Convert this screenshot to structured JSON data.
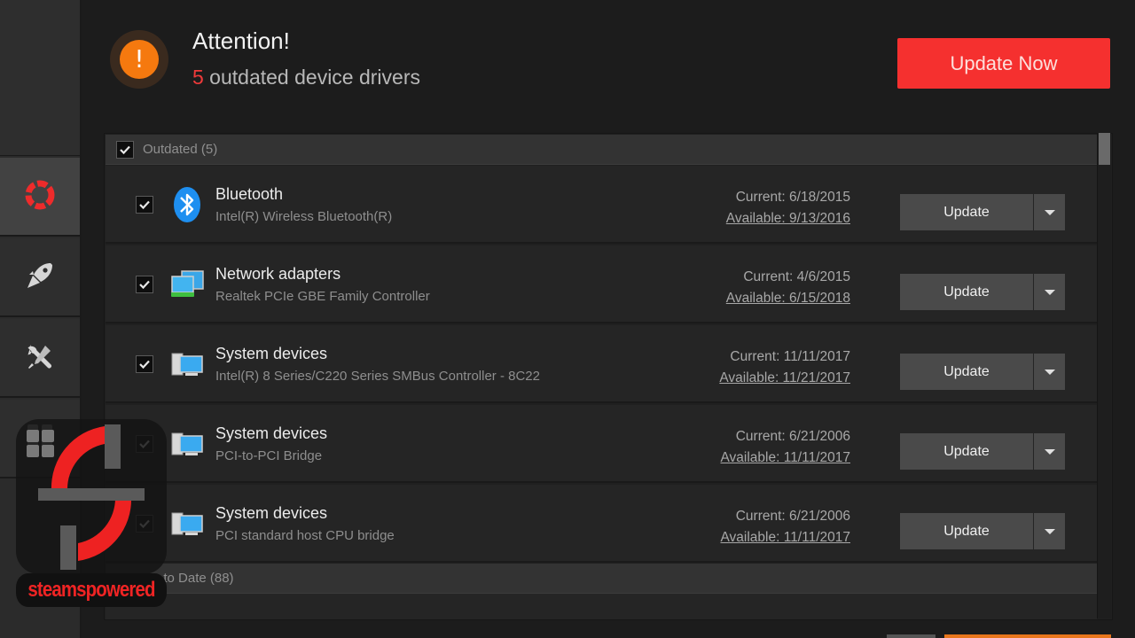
{
  "header": {
    "title": "Attention!",
    "outdated_count": "5",
    "subtitle_text": " outdated device drivers",
    "update_now_label": "Update Now"
  },
  "sidebar": {
    "items": [
      {
        "name": "scan",
        "icon": "lifebuoy-icon",
        "active": true
      },
      {
        "name": "boost",
        "icon": "rocket-icon",
        "active": false
      },
      {
        "name": "tools",
        "icon": "tools-icon",
        "active": false
      },
      {
        "name": "action-center",
        "icon": "grid-icon",
        "active": false
      }
    ]
  },
  "groups": {
    "outdated": {
      "label": "Outdated (5)",
      "checked": true
    },
    "uptodate": {
      "label": "Up to Date (88)"
    }
  },
  "devices": [
    {
      "category": "Bluetooth",
      "description": "Intel(R) Wireless Bluetooth(R)",
      "current": "Current: 6/18/2015",
      "available": "Available: 9/13/2016",
      "icon": "bluetooth-icon",
      "checked": true
    },
    {
      "category": "Network adapters",
      "description": "Realtek PCIe GBE Family Controller",
      "current": "Current: 4/6/2015",
      "available": "Available: 6/15/2018",
      "icon": "network-adapter-icon",
      "checked": true
    },
    {
      "category": "System devices",
      "description": "Intel(R) 8 Series/C220 Series SMBus Controller - 8C22",
      "current": "Current: 11/11/2017",
      "available": "Available: 11/21/2017",
      "icon": "computer-icon",
      "checked": true
    },
    {
      "category": "System devices",
      "description": "PCI-to-PCI Bridge",
      "current": "Current: 6/21/2006",
      "available": "Available: 11/11/2017",
      "icon": "computer-icon",
      "checked": true
    },
    {
      "category": "System devices",
      "description": "PCI standard host CPU bridge",
      "current": "Current: 6/21/2006",
      "available": "Available: 11/11/2017",
      "icon": "computer-icon",
      "checked": true
    }
  ],
  "row_update_label": "Update",
  "watermark": {
    "text": "steamspowered"
  },
  "colors": {
    "accent_red": "#f5302f",
    "alert_orange": "#f5790f",
    "bluetooth_blue": "#1e8ff0"
  }
}
